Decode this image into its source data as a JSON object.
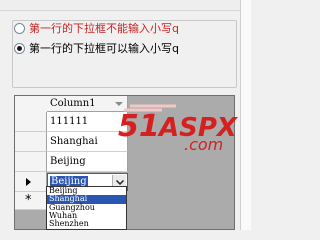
{
  "options": [
    {
      "label": "第一行的下拉框不能输入小写q",
      "checked": false,
      "color": "#cc2222"
    },
    {
      "label": "第一行的下拉框可以输入小写q",
      "checked": true,
      "color": "#000000"
    }
  ],
  "grid": {
    "column_header": "Column1",
    "rows": [
      "111111",
      "Shanghai",
      "Beijing"
    ],
    "new_row_marker": "*",
    "editing": {
      "value": "Beijing",
      "dropdown_options": [
        "Beijing",
        "Shanghai",
        "Guangzhou",
        "Wuhan",
        "Shenzhen"
      ],
      "highlighted_option": "Shanghai"
    }
  },
  "watermark": {
    "number": "51",
    "brand": "ASPX",
    "suffix": ".com"
  }
}
